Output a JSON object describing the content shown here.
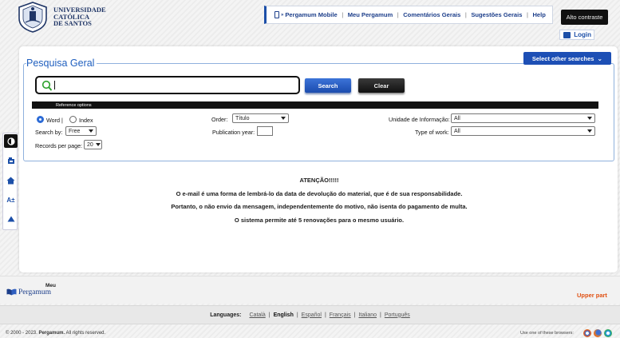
{
  "header": {
    "logo_lines": [
      "UNIVERSIDADE",
      "CATÓLICA",
      "DE SANTOS"
    ],
    "nav": [
      {
        "label": "Pergamum Mobile",
        "icon": "mobile-icon"
      },
      {
        "label": "Meu Pergamum"
      },
      {
        "label": "Comentários Gerais"
      },
      {
        "label": "Sugestões Gerais"
      },
      {
        "label": "Help"
      }
    ],
    "contrast_label": "Alto contraste",
    "login_label": "Login"
  },
  "search": {
    "legend": "Pesquisa Geral",
    "other_searches_label": "Select other searches",
    "input_value": "",
    "search_button": "Search",
    "clear_button": "Clear",
    "reference_options_label": "Reference options",
    "mode": {
      "word": "Word",
      "index": "Index",
      "selected": "Word"
    },
    "search_by": {
      "label": "Search by:",
      "value": "Free"
    },
    "records_per_page": {
      "label": "Records per page:",
      "value": "20"
    },
    "order": {
      "label": "Order:",
      "value": "Título"
    },
    "publication_year": {
      "label": "Publication year:",
      "value": ""
    },
    "unidade": {
      "label": "Unidade de Informação:",
      "value": "All"
    },
    "type_of_work": {
      "label": "Type of work:",
      "value": "All"
    }
  },
  "sidebar": {
    "icons": [
      "contrast-icon",
      "library-icon",
      "home-icon",
      "font-size-icon",
      "scroll-top-icon"
    ],
    "font_size_text": "A±"
  },
  "notice": {
    "title": "ATENÇÃO!!!!!",
    "lines": [
      "O e-mail é uma forma de lembrá-lo da data de devolução do material, que é de sua responsabilidade.",
      "Portanto, o não envio da mensagem, independentemente do motivo, não isenta do pagamento de multa.",
      "O sistema permite até 5 renovações para o mesmo usuário."
    ]
  },
  "footer": {
    "logo_top": "Meu",
    "logo_bottom": "Pergamum",
    "upper_part": "Upper part",
    "languages_label": "Languages:",
    "languages": [
      "Català",
      "English",
      "Español",
      "Français",
      "Italiano",
      "Português"
    ],
    "current_language": "English",
    "copyright_prefix": "© 2000 - 2023.",
    "copyright_brand": "Pergamum.",
    "copyright_suffix": "All rights reserved.",
    "browsers_text": "Use one of these browsers:"
  },
  "colors": {
    "accent_blue": "#1c4fa8",
    "legend_blue": "#1f5fbf",
    "upper_part_orange": "#e05012"
  }
}
